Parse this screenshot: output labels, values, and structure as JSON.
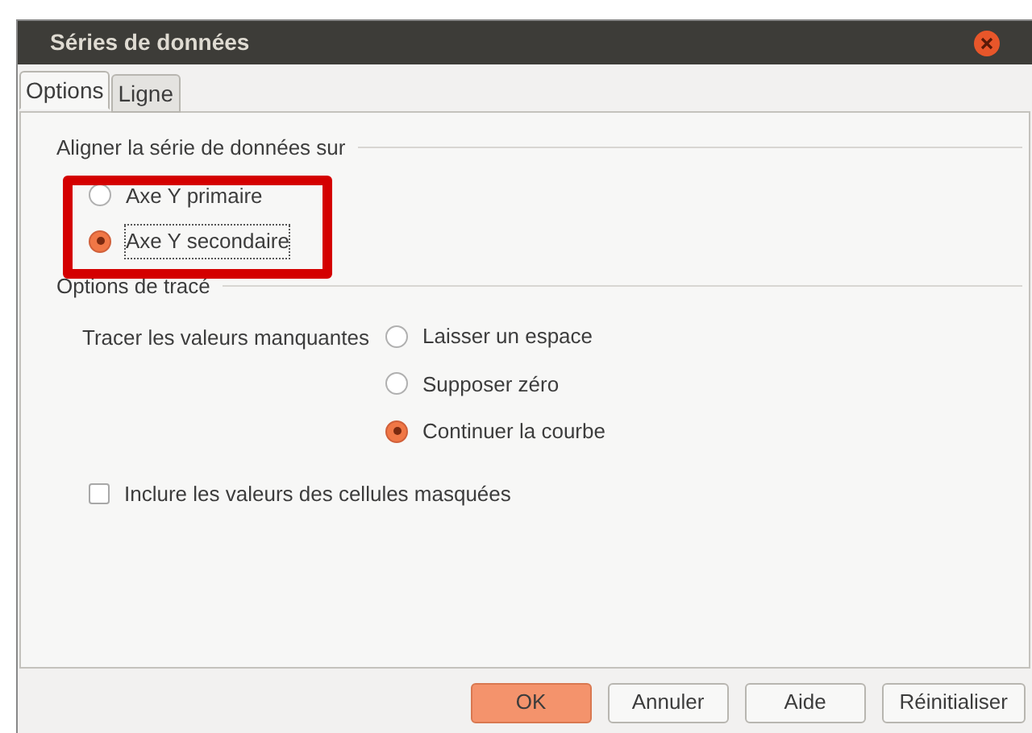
{
  "window": {
    "title": "Séries de données"
  },
  "tabs": [
    {
      "label": "Options",
      "selected": true
    },
    {
      "label": "Ligne",
      "selected": false
    }
  ],
  "align_section": {
    "heading": "Aligner la série de données sur",
    "options": [
      {
        "label": "Axe Y primaire",
        "selected": false
      },
      {
        "label": "Axe Y secondaire",
        "selected": true
      }
    ]
  },
  "highlight": {
    "on": true
  },
  "plot_section": {
    "heading": "Options de tracé",
    "missing_label": "Tracer les valeurs manquantes",
    "options": [
      {
        "label": "Laisser un espace",
        "selected": false
      },
      {
        "label": "Supposer zéro",
        "selected": false
      },
      {
        "label": "Continuer la courbe",
        "selected": true
      }
    ],
    "hidden_cells": {
      "label": "Inclure les valeurs des cellules masquées",
      "checked": false
    }
  },
  "buttons": [
    {
      "label": "OK",
      "kind": "primary"
    },
    {
      "label": "Annuler",
      "kind": "normal"
    },
    {
      "label": "Aide",
      "kind": "normal"
    },
    {
      "label": "Réinitialiser",
      "kind": "normal"
    }
  ]
}
